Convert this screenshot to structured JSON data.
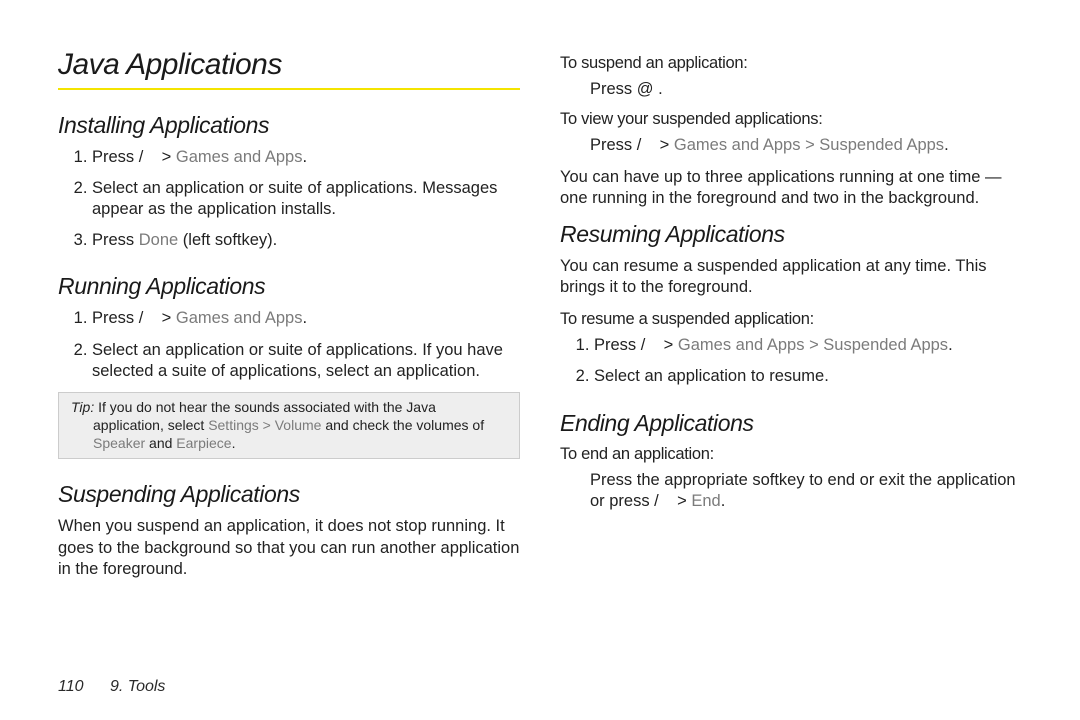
{
  "title": "Java Applications",
  "left": {
    "installing": {
      "heading": "Installing Applications",
      "step1_a": "Press /    > ",
      "step1_b": "Games and Apps",
      "step1_c": ".",
      "step2": "Select an application or suite of applications. Messages appear as the application installs.",
      "step3_a": "Press ",
      "step3_b": "Done",
      "step3_c": " (left softkey)."
    },
    "running": {
      "heading": "Running Applications",
      "step1_a": "Press /    > ",
      "step1_b": "Games and Apps",
      "step1_c": ".",
      "step2": "Select an application or suite of applications. If you have selected a suite of applications, select an application."
    },
    "tip": {
      "label": "Tip:",
      "t1": " If you do not hear the sounds associated with the Java application, select ",
      "t2": "Settings > Volume",
      "t3": "  and check the volumes of ",
      "t4": "Speaker",
      "t5": " and ",
      "t6": "Earpiece",
      "t7": "."
    },
    "suspending": {
      "heading": "Suspending Applications",
      "para": "When you suspend an application, it does not stop running. It goes to the background so that you can run another application in the foreground."
    }
  },
  "right": {
    "suspend_lead": "To suspend an application:",
    "suspend_step": "Press @ .",
    "view_lead": "To view your suspended applications:",
    "view_step_a": "Press /    > ",
    "view_step_b": "Games and Apps > Suspended Apps",
    "view_step_c": ".",
    "note": "You can have up to three applications running at one time — one running in the foreground and two in the background.",
    "resuming": {
      "heading": "Resuming Applications",
      "para": "You can resume a suspended application at any time. This brings it to the foreground.",
      "lead": "To resume a suspended application:",
      "step1_a": "Press /    > ",
      "step1_b": "Games and Apps > Suspended Apps",
      "step1_c": ".",
      "step2": "Select an application to resume."
    },
    "ending": {
      "heading": "Ending Applications",
      "lead": "To end an application:",
      "step_a": "Press the appropriate softkey to end or exit the application or press /    > ",
      "step_b": "End",
      "step_c": "."
    }
  },
  "footer": {
    "page": "110",
    "chapter": "9. Tools"
  }
}
